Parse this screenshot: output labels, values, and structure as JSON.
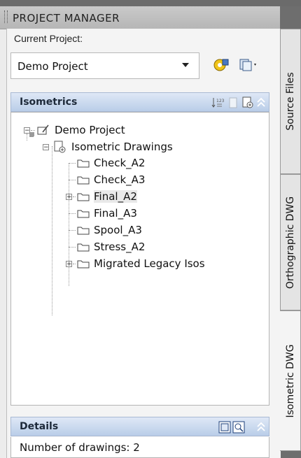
{
  "title": "PROJECT MANAGER",
  "current_project": {
    "label": "Current Project:",
    "value": "Demo Project"
  },
  "sections": {
    "isometrics": "Isometrics",
    "details": "Details"
  },
  "tree": {
    "root": "Demo Project",
    "group": "Isometric Drawings",
    "items": [
      "Check_A2",
      "Check_A3",
      "Final_A2",
      "Final_A3",
      "Spool_A3",
      "Stress_A2",
      "Migrated Legacy Isos"
    ]
  },
  "details": {
    "text": "Number of drawings: 2"
  },
  "side_tabs": [
    "Source Files",
    "Orthographic DWG",
    "Isometric DWG"
  ],
  "icons": {
    "project_settings": "project-settings-icon",
    "project_switch": "project-switch-icon",
    "sort": "sort-icon",
    "list_view": "list-view-icon",
    "drawing_properties": "drawing-properties-icon",
    "collapse": "collapse-chevron-icon"
  }
}
